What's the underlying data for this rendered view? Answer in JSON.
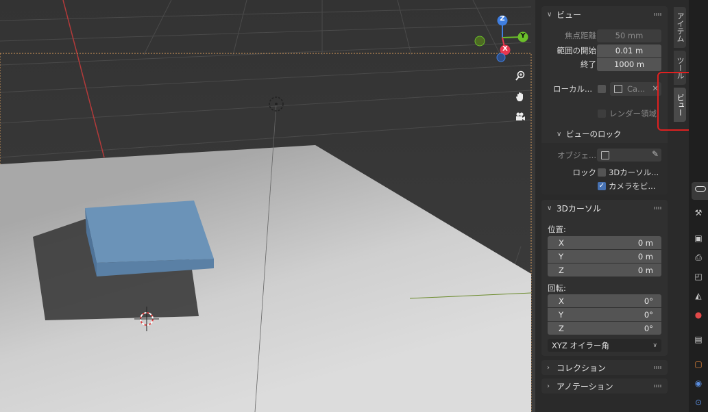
{
  "view_panel": {
    "title": "ビュー",
    "focal_label": "焦点距離",
    "focal_value": "50 mm",
    "clip_start_label": "範囲の開始",
    "clip_start_value": "0.01 m",
    "clip_end_label": "終了",
    "clip_end_value": "1000 m",
    "local_label": "ローカル...",
    "local_camera_value": "Ca...",
    "render_region_label": "レンダー領域",
    "lock_section_title": "ビューのロック",
    "lock_object_label": "オブジェ...",
    "lock_label": "ロック",
    "lock_cursor_label": "3Dカーソル...",
    "camera_to_view_label": "カメラをビ...",
    "camera_to_view_checked": true
  },
  "cursor_panel": {
    "title": "3Dカーソル",
    "location_label": "位置:",
    "location": [
      {
        "axis": "X",
        "value": "0 m"
      },
      {
        "axis": "Y",
        "value": "0 m"
      },
      {
        "axis": "Z",
        "value": "0 m"
      }
    ],
    "rotation_label": "回転:",
    "rotation": [
      {
        "axis": "X",
        "value": "0°"
      },
      {
        "axis": "Y",
        "value": "0°"
      },
      {
        "axis": "Z",
        "value": "0°"
      }
    ],
    "rotation_mode": "XYZ オイラー角"
  },
  "collection_panel": {
    "title": "コレクション"
  },
  "annotation_panel": {
    "title": "アノテーション"
  },
  "sidebar_tabs": [
    "アイテム",
    "ツール",
    "ビュー"
  ],
  "active_tab": "ビュー",
  "gizmo": {
    "x": "X",
    "y": "Y",
    "z": "Z"
  },
  "colors": {
    "accent": "#4772b3",
    "highlight_box": "#e02020",
    "arrow": "#e0141e",
    "axis_x": "#e8374f",
    "axis_y": "#6bbf2a",
    "axis_z": "#3f7ee0"
  }
}
